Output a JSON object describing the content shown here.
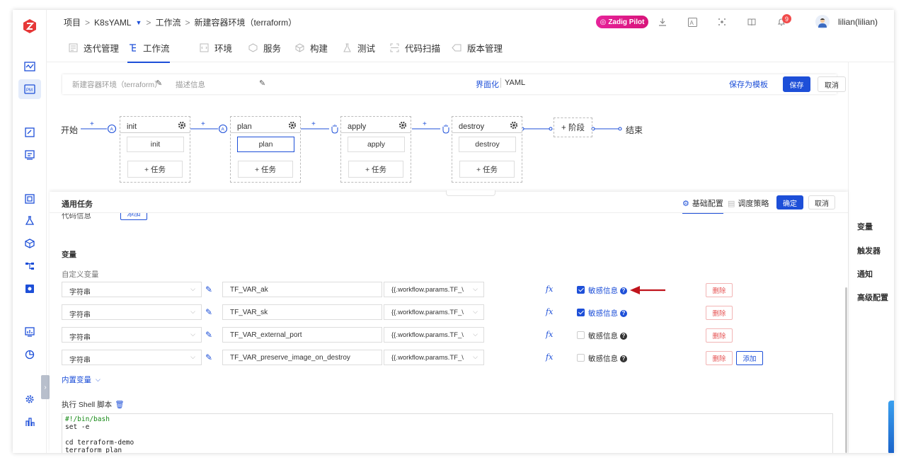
{
  "breadcrumb": {
    "project": "项目",
    "project_name": "K8sYAML",
    "workflow": "工作流",
    "current": "新建容器环境（terraform）"
  },
  "topbar": {
    "pilot_label": "Zadig Pilot",
    "notification_count": "9",
    "username": "lilian(lilian)"
  },
  "nav": {
    "tabs": [
      "迭代管理",
      "工作流",
      "环境",
      "服务",
      "构建",
      "测试",
      "代码扫描",
      "版本管理"
    ],
    "active": "工作流"
  },
  "workflow_header": {
    "name": "新建容器环境（terraform）",
    "description_placeholder": "描述信息",
    "mode_visual": "界面化",
    "mode_yaml": "YAML",
    "save_as_template": "保存为模板",
    "save": "保存",
    "cancel": "取消"
  },
  "flow": {
    "start": "开始",
    "end": "结束",
    "add_stage": "+ 阶段",
    "add_job": "+ 任务",
    "plus": "+",
    "stages": [
      {
        "name": "init",
        "job": "init"
      },
      {
        "name": "plan",
        "job": "plan"
      },
      {
        "name": "apply",
        "job": "apply"
      },
      {
        "name": "destroy",
        "job": "destroy"
      }
    ],
    "selected_job": "plan"
  },
  "task_panel": {
    "title": "通用任务",
    "tab_basic": "基础配置",
    "tab_schedule": "调度策略",
    "confirm": "确定",
    "cancel": "取消",
    "code_info_label": "代码信息",
    "code_info_add": "添加",
    "variables_label": "变量",
    "custom_vars_label": "自定义变量",
    "builtin_vars_label": "内置变量",
    "shell_label": "执行 Shell 脚本",
    "variables": [
      {
        "type": "字符串",
        "key": "TF_VAR_ak",
        "value": "{{.workflow.params.TF_\\",
        "sensitive": true
      },
      {
        "type": "字符串",
        "key": "TF_VAR_sk",
        "value": "{{.workflow.params.TF_\\",
        "sensitive": true
      },
      {
        "type": "字符串",
        "key": "TF_VAR_external_port",
        "value": "{{.workflow.params.TF_\\",
        "sensitive": false
      },
      {
        "type": "字符串",
        "key": "TF_VAR_preserve_image_on_destroy",
        "value": "{{.workflow.params.TF_\\",
        "sensitive": false
      }
    ],
    "sensitive_label": "敏感信息",
    "delete_label": "删除",
    "add_label": "添加",
    "script_lines": [
      "#!/bin/bash",
      "set -e",
      "",
      "cd terraform-demo",
      "terraform plan"
    ]
  },
  "right_panel": {
    "items": [
      "变量",
      "触发器",
      "通知",
      "高级配置"
    ]
  },
  "colors": {
    "primary": "#1d4fd8",
    "danger": "#e55050",
    "annotation_arrow": "#c0141c"
  }
}
